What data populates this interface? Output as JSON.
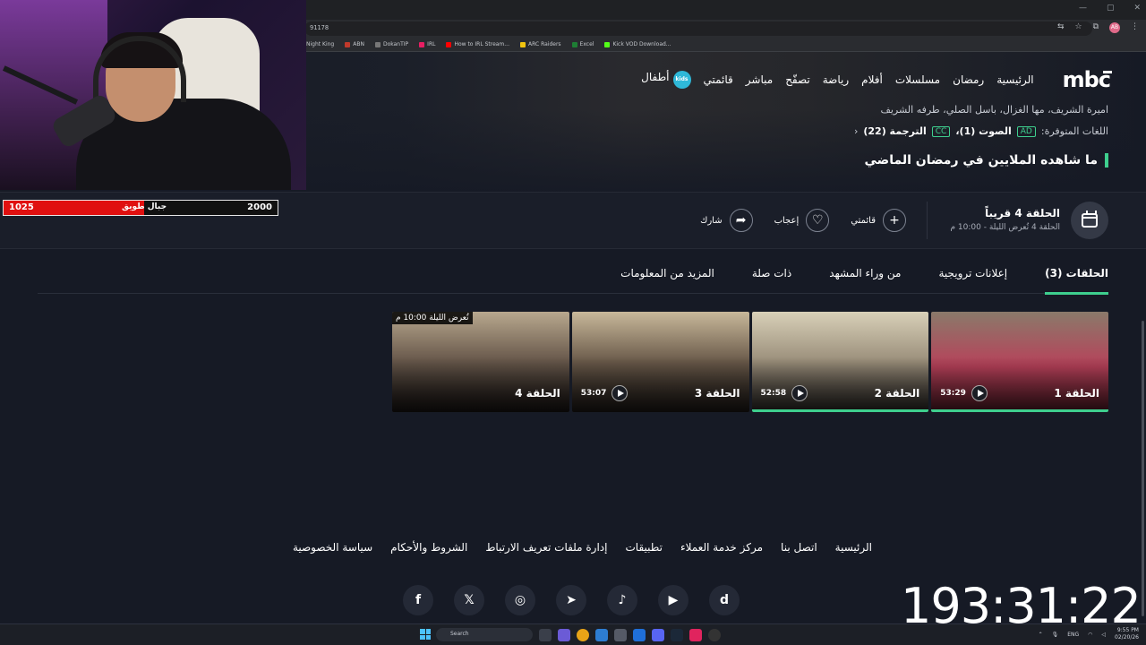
{
  "browser": {
    "url": "91178",
    "bookmarks": [
      "Night King",
      "ABN",
      "DokanTIP",
      "IRL",
      "How to IRL Stream...",
      "ARC Raiders",
      "Excel",
      "Kick VOD Download..."
    ],
    "profile_initials": "AB"
  },
  "nav": {
    "logo": "mbc",
    "items": [
      "الرئيسية",
      "رمضان",
      "مسلسلات",
      "أفلام",
      "رياضة",
      "تصفّح",
      "مباشر",
      "قائمتي"
    ],
    "kids_badge": "kids",
    "kids_label": "أطفال"
  },
  "show": {
    "cast": "اميرة الشريف، مها الغزال، باسل الصلي، طرفه الشريف",
    "langs_label": "اللغات المتوفرة:",
    "ad_badge": "AD",
    "audio": "الصوت (1)،",
    "cc_badge": "CC",
    "subtitles": "الترجمة (22)",
    "tagline": "ما شاهده الملايين في رمضان الماضي"
  },
  "upcoming": {
    "title": "الحلقة 4 قريباً",
    "subtitle": "الحلقة 4 تُعرض الليلة - 10:00 م"
  },
  "actions": {
    "mylist": "قائمتي",
    "like": "إعجاب",
    "share": "شارك"
  },
  "tabs": [
    "الحلقات (3)",
    "إعلانات ترويجية",
    "من وراء المشهد",
    "ذات صلة",
    "المزيد من المعلومات"
  ],
  "episodes": [
    {
      "title": "الحلقة 1",
      "duration": "53:29",
      "progress": 1.0
    },
    {
      "title": "الحلقة 2",
      "duration": "52:58",
      "progress": 1.0
    },
    {
      "title": "الحلقة 3",
      "duration": "53:07",
      "progress": 0
    },
    {
      "title": "الحلقة 4",
      "tag": "تُعرض الليلة 10:00 م",
      "progress": 0
    }
  ],
  "footer": {
    "links": [
      "الرئيسية",
      "اتصل بنا",
      "مركز خدمة العملاء",
      "تطبيقات",
      "إدارة ملفات تعريف الارتباط",
      "الشروط والأحكام",
      "سياسة الخصوصية"
    ],
    "socials": [
      "facebook-icon",
      "x-icon",
      "instagram-icon",
      "telegram-icon",
      "tiktok-icon",
      "youtube-icon",
      "dailymotion-icon"
    ]
  },
  "overlay": {
    "subathon_left": "1025",
    "subathon_label": "جبال طويق",
    "subathon_right": "2000",
    "subathon_fill": 0.5125,
    "timer": "193:31:22"
  },
  "taskbar": {
    "search": "Search",
    "lang": "ENG",
    "time": "9:55 PM",
    "date": "02/20/26"
  }
}
